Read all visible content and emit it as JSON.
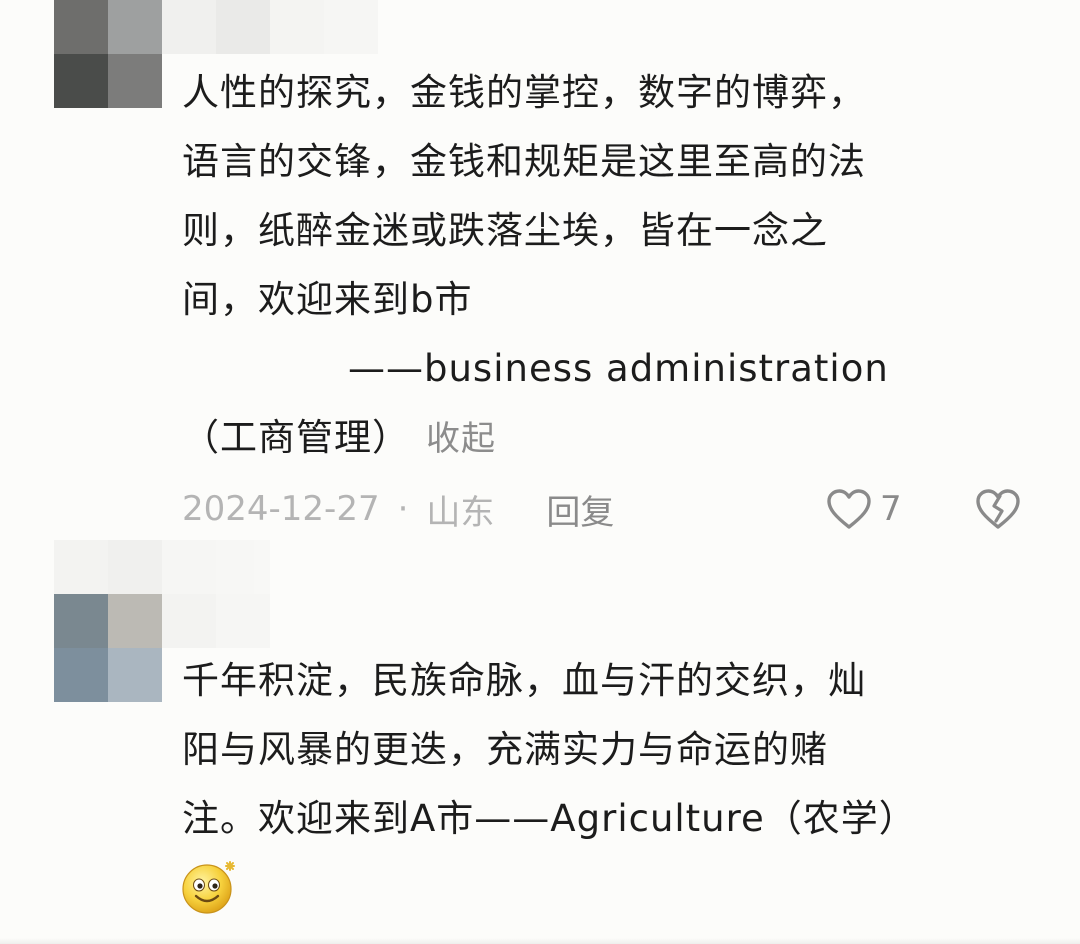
{
  "comments": [
    {
      "text_lines": [
        "人性的探究，金钱的掌控，数字的博弈，",
        "语言的交锋，金钱和规矩是这里至高的法",
        "则，纸醉金迷或跌落尘埃，皆在一念之",
        "间，欢迎来到b市",
        "——business administration",
        "（工商管理）"
      ],
      "collapse_label": "收起",
      "date": "2024-12-27",
      "separator": "·",
      "location": "山东",
      "reply_label": "回复",
      "like_count": "7",
      "icons": {
        "like": "heart-outline-icon",
        "dislike": "broken-heart-icon"
      }
    },
    {
      "text_lines": [
        "千年积淀，民族命脉，血与汗的交织，灿",
        "阳与风暴的更迭，充满实力与命运的赌",
        "注。欢迎来到A市——Agriculture（农学）"
      ],
      "emoji": "smiling-face-sparkle-emoji"
    }
  ],
  "colors": {
    "background": "#fcfcfa",
    "text": "#1c1c1c",
    "meta_text": "#b4b4b4",
    "action_text": "#8a8a8a",
    "avatar_1_tiles": [
      "#6e6e6c",
      "#9ea0a0",
      "#4a4c4a",
      "#7c7c7b"
    ],
    "name_1_tiles": [
      "#e8e8e6",
      "#dcdcda",
      "#eeeeec",
      "#f2f2f0"
    ],
    "avatar_2_tiles": [
      "#7a8890",
      "#bcbab4",
      "#7d8f9d",
      "#aab6c0"
    ],
    "name_2_tiles": [
      "#e4e4e2",
      "#dadad8",
      "#ecece9",
      "#f0f0ee"
    ],
    "name_2b_tiles": [
      "#e6e6e4",
      "#eeeeec"
    ]
  }
}
